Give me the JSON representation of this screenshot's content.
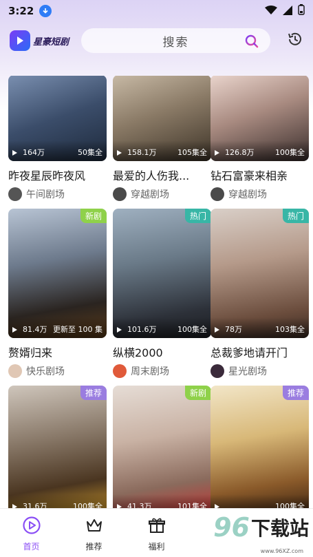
{
  "status_bar": {
    "time": "3:22"
  },
  "header": {
    "logo_text": "星豪短剧",
    "search_placeholder": "搜索"
  },
  "cards": [
    {
      "title": "昨夜星辰昨夜风",
      "plays": "164万",
      "episodes": "50集全",
      "tag": "",
      "source": "午间剧场"
    },
    {
      "title": "最爱的人伤我...",
      "plays": "158.1万",
      "episodes": "105集全",
      "tag": "",
      "source": "穿越剧场"
    },
    {
      "title": "钻石富豪来相亲",
      "plays": "126.8万",
      "episodes": "100集全",
      "tag": "",
      "source": "穿越剧场"
    },
    {
      "title": "赘婿归来",
      "plays": "81.4万",
      "episodes": "更新至 100 集",
      "tag": "新剧",
      "source": "快乐剧场"
    },
    {
      "title": "纵横2000",
      "plays": "101.6万",
      "episodes": "100集全",
      "tag": "热门",
      "source": "周末剧场"
    },
    {
      "title": "总裁爹地请开门",
      "plays": "78万",
      "episodes": "103集全",
      "tag": "热门",
      "source": "星光剧场"
    },
    {
      "title": "",
      "plays": "31.6万",
      "episodes": "100集全",
      "tag": "推荐",
      "source": ""
    },
    {
      "title": "",
      "plays": "41.3万",
      "episodes": "101集全",
      "tag": "新剧",
      "source": ""
    },
    {
      "title": "",
      "plays": "",
      "episodes": "100集全",
      "tag": "推荐",
      "source": ""
    }
  ],
  "tabbar": {
    "home": "首页",
    "recommend": "推荐",
    "welfare": "福利"
  },
  "watermark": {
    "num": "96",
    "text": "下载站",
    "url": "www.96XZ.com"
  }
}
